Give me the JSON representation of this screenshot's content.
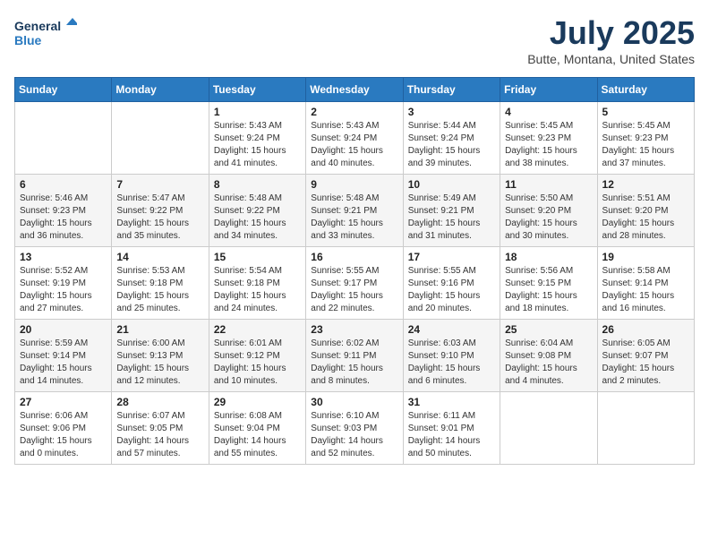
{
  "logo": {
    "line1": "General",
    "line2": "Blue"
  },
  "title": "July 2025",
  "location": "Butte, Montana, United States",
  "weekdays": [
    "Sunday",
    "Monday",
    "Tuesday",
    "Wednesday",
    "Thursday",
    "Friday",
    "Saturday"
  ],
  "weeks": [
    [
      {
        "day": "",
        "info": ""
      },
      {
        "day": "",
        "info": ""
      },
      {
        "day": "1",
        "info": "Sunrise: 5:43 AM\nSunset: 9:24 PM\nDaylight: 15 hours\nand 41 minutes."
      },
      {
        "day": "2",
        "info": "Sunrise: 5:43 AM\nSunset: 9:24 PM\nDaylight: 15 hours\nand 40 minutes."
      },
      {
        "day": "3",
        "info": "Sunrise: 5:44 AM\nSunset: 9:24 PM\nDaylight: 15 hours\nand 39 minutes."
      },
      {
        "day": "4",
        "info": "Sunrise: 5:45 AM\nSunset: 9:23 PM\nDaylight: 15 hours\nand 38 minutes."
      },
      {
        "day": "5",
        "info": "Sunrise: 5:45 AM\nSunset: 9:23 PM\nDaylight: 15 hours\nand 37 minutes."
      }
    ],
    [
      {
        "day": "6",
        "info": "Sunrise: 5:46 AM\nSunset: 9:23 PM\nDaylight: 15 hours\nand 36 minutes."
      },
      {
        "day": "7",
        "info": "Sunrise: 5:47 AM\nSunset: 9:22 PM\nDaylight: 15 hours\nand 35 minutes."
      },
      {
        "day": "8",
        "info": "Sunrise: 5:48 AM\nSunset: 9:22 PM\nDaylight: 15 hours\nand 34 minutes."
      },
      {
        "day": "9",
        "info": "Sunrise: 5:48 AM\nSunset: 9:21 PM\nDaylight: 15 hours\nand 33 minutes."
      },
      {
        "day": "10",
        "info": "Sunrise: 5:49 AM\nSunset: 9:21 PM\nDaylight: 15 hours\nand 31 minutes."
      },
      {
        "day": "11",
        "info": "Sunrise: 5:50 AM\nSunset: 9:20 PM\nDaylight: 15 hours\nand 30 minutes."
      },
      {
        "day": "12",
        "info": "Sunrise: 5:51 AM\nSunset: 9:20 PM\nDaylight: 15 hours\nand 28 minutes."
      }
    ],
    [
      {
        "day": "13",
        "info": "Sunrise: 5:52 AM\nSunset: 9:19 PM\nDaylight: 15 hours\nand 27 minutes."
      },
      {
        "day": "14",
        "info": "Sunrise: 5:53 AM\nSunset: 9:18 PM\nDaylight: 15 hours\nand 25 minutes."
      },
      {
        "day": "15",
        "info": "Sunrise: 5:54 AM\nSunset: 9:18 PM\nDaylight: 15 hours\nand 24 minutes."
      },
      {
        "day": "16",
        "info": "Sunrise: 5:55 AM\nSunset: 9:17 PM\nDaylight: 15 hours\nand 22 minutes."
      },
      {
        "day": "17",
        "info": "Sunrise: 5:55 AM\nSunset: 9:16 PM\nDaylight: 15 hours\nand 20 minutes."
      },
      {
        "day": "18",
        "info": "Sunrise: 5:56 AM\nSunset: 9:15 PM\nDaylight: 15 hours\nand 18 minutes."
      },
      {
        "day": "19",
        "info": "Sunrise: 5:58 AM\nSunset: 9:14 PM\nDaylight: 15 hours\nand 16 minutes."
      }
    ],
    [
      {
        "day": "20",
        "info": "Sunrise: 5:59 AM\nSunset: 9:14 PM\nDaylight: 15 hours\nand 14 minutes."
      },
      {
        "day": "21",
        "info": "Sunrise: 6:00 AM\nSunset: 9:13 PM\nDaylight: 15 hours\nand 12 minutes."
      },
      {
        "day": "22",
        "info": "Sunrise: 6:01 AM\nSunset: 9:12 PM\nDaylight: 15 hours\nand 10 minutes."
      },
      {
        "day": "23",
        "info": "Sunrise: 6:02 AM\nSunset: 9:11 PM\nDaylight: 15 hours\nand 8 minutes."
      },
      {
        "day": "24",
        "info": "Sunrise: 6:03 AM\nSunset: 9:10 PM\nDaylight: 15 hours\nand 6 minutes."
      },
      {
        "day": "25",
        "info": "Sunrise: 6:04 AM\nSunset: 9:08 PM\nDaylight: 15 hours\nand 4 minutes."
      },
      {
        "day": "26",
        "info": "Sunrise: 6:05 AM\nSunset: 9:07 PM\nDaylight: 15 hours\nand 2 minutes."
      }
    ],
    [
      {
        "day": "27",
        "info": "Sunrise: 6:06 AM\nSunset: 9:06 PM\nDaylight: 15 hours\nand 0 minutes."
      },
      {
        "day": "28",
        "info": "Sunrise: 6:07 AM\nSunset: 9:05 PM\nDaylight: 14 hours\nand 57 minutes."
      },
      {
        "day": "29",
        "info": "Sunrise: 6:08 AM\nSunset: 9:04 PM\nDaylight: 14 hours\nand 55 minutes."
      },
      {
        "day": "30",
        "info": "Sunrise: 6:10 AM\nSunset: 9:03 PM\nDaylight: 14 hours\nand 52 minutes."
      },
      {
        "day": "31",
        "info": "Sunrise: 6:11 AM\nSunset: 9:01 PM\nDaylight: 14 hours\nand 50 minutes."
      },
      {
        "day": "",
        "info": ""
      },
      {
        "day": "",
        "info": ""
      }
    ]
  ]
}
